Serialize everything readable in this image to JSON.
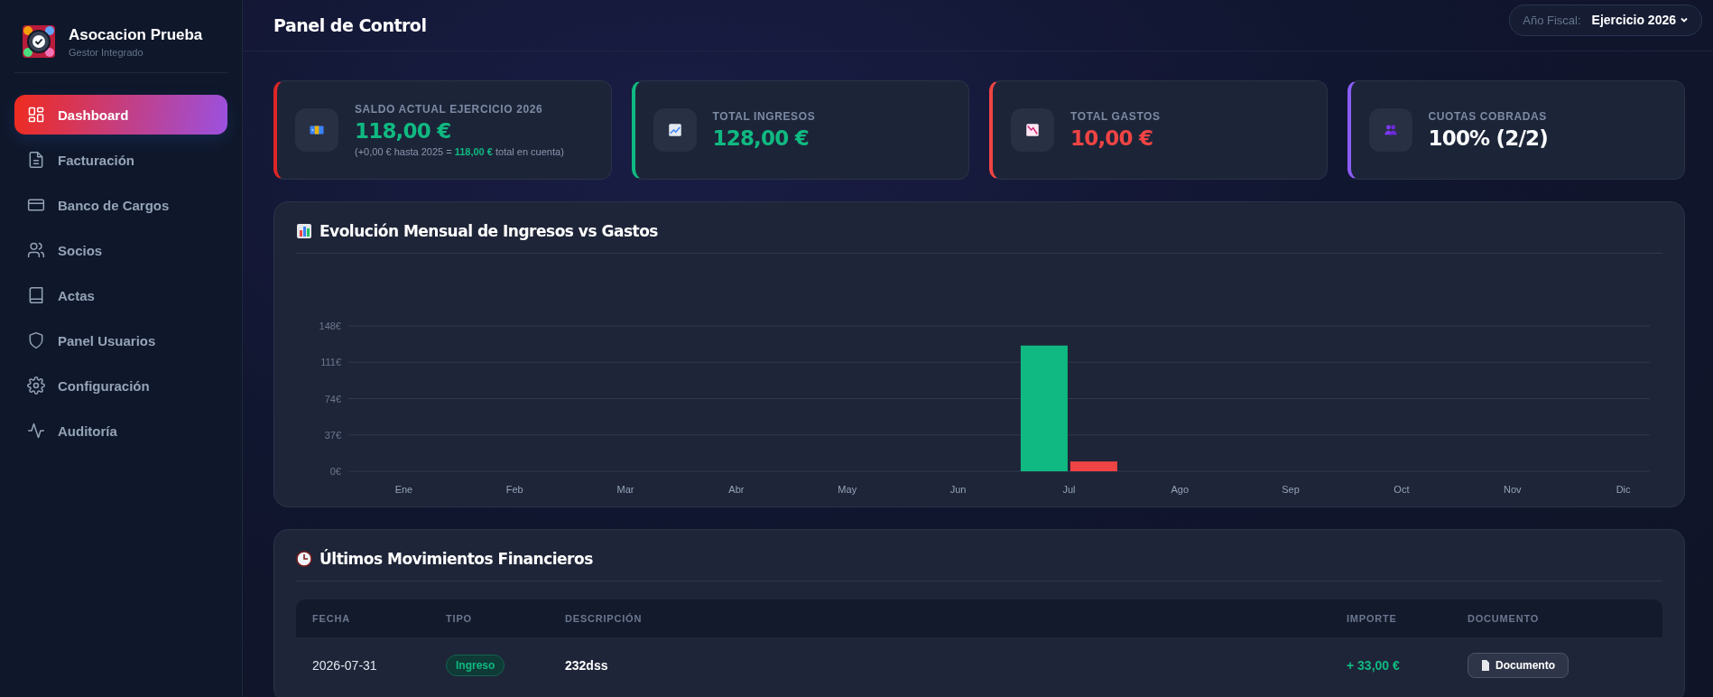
{
  "sidebar": {
    "brand": {
      "title": "Asocacion Prueba",
      "subtitle": "Gestor Integrado"
    },
    "items": [
      {
        "label": "Dashboard",
        "selected": true
      },
      {
        "label": "Facturación",
        "selected": false
      },
      {
        "label": "Banco de Cargos",
        "selected": false
      },
      {
        "label": "Socios",
        "selected": false
      },
      {
        "label": "Actas",
        "selected": false
      },
      {
        "label": "Panel Usuarios",
        "selected": false
      },
      {
        "label": "Configuración",
        "selected": false
      },
      {
        "label": "Auditoría",
        "selected": false
      }
    ]
  },
  "header": {
    "title": "Panel de Control",
    "fiscal_year": {
      "label": "Año Fiscal:",
      "value": "Ejercicio 2026"
    }
  },
  "stats": [
    {
      "label": "SALDO ACTUAL EJERCICIO 2026",
      "value": "118,00 €",
      "kind": "positive",
      "color": "#dc2626",
      "note": "(+0,00 € hasta 2025 = **118,00 €** total en cuenta)"
    },
    {
      "label": "TOTAL INGRESOS",
      "value": "128,00 €",
      "kind": "positive",
      "color": "#10b981"
    },
    {
      "label": "TOTAL GASTOS",
      "value": "10,00 €",
      "kind": "negative",
      "color": "#ef4444"
    },
    {
      "label": "CUOTAS COBRADAS",
      "value": "100% (2/2)",
      "kind": "neutral",
      "color": "#8b5cf6"
    }
  ],
  "chart_panel": {
    "title": "Evolución Mensual de Ingresos vs Gastos",
    "chart_data": {
      "type": "bar",
      "categories": [
        "Ene",
        "Feb",
        "Mar",
        "Abr",
        "May",
        "Jun",
        "Jul",
        "Ago",
        "Sep",
        "Oct",
        "Nov",
        "Dic"
      ],
      "series": [
        {
          "color": "#10b981",
          "values": [
            0,
            0,
            0,
            0,
            0,
            0,
            128,
            0,
            0,
            0,
            0,
            0
          ]
        },
        {
          "color": "#ef4444",
          "values": [
            0,
            0,
            0,
            0,
            0,
            0,
            10,
            0,
            0,
            0,
            0,
            0
          ]
        }
      ],
      "ylim": [
        0,
        148
      ],
      "grid": true,
      "yticks": [
        {
          "value": 0,
          "label": "0€"
        },
        {
          "value": 37,
          "label": "37€"
        },
        {
          "value": 74,
          "label": "74€"
        },
        {
          "value": 111,
          "label": "111€"
        },
        {
          "value": 148,
          "label": "148€"
        }
      ]
    }
  },
  "movements": {
    "title": "Últimos Movimientos Financieros",
    "columns": [
      "FECHA",
      "TIPO",
      "DESCRIPCIÓN",
      "IMPORTE",
      "DOCUMENTO"
    ],
    "rows": [
      {
        "date": "2026-07-31",
        "type": {
          "label": "Ingreso",
          "kind": "income"
        },
        "description": "232dss",
        "amount": "+ 33,00 €",
        "document": "Documento"
      }
    ]
  }
}
